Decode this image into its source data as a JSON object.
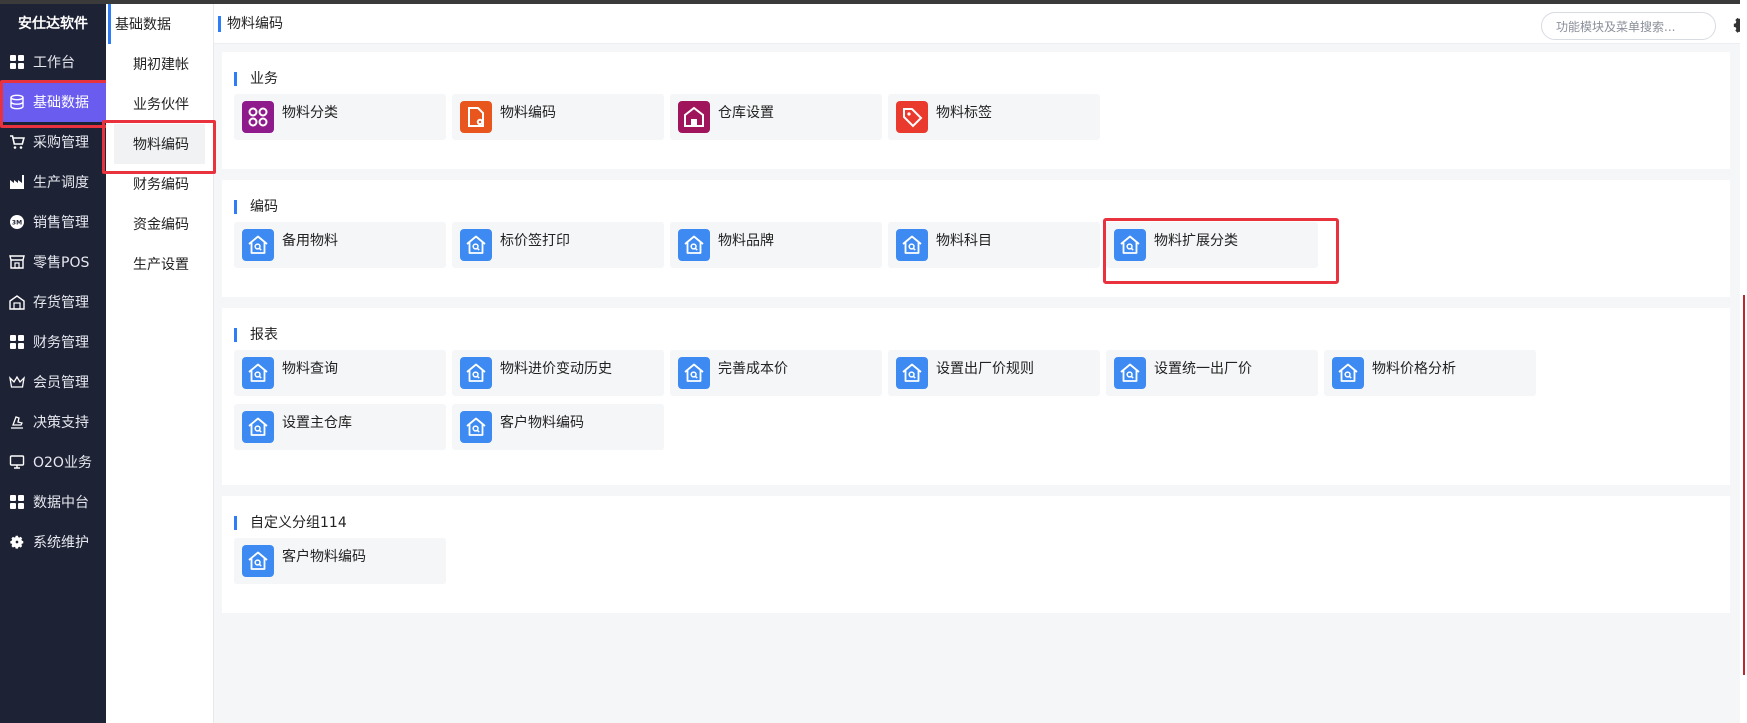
{
  "app": {
    "name": "安仕达软件"
  },
  "nav": {
    "items": [
      {
        "label": "工作台",
        "icon": "grid-icon"
      },
      {
        "label": "基础数据",
        "icon": "database-icon",
        "active": true
      },
      {
        "label": "采购管理",
        "icon": "cart-icon"
      },
      {
        "label": "生产调度",
        "icon": "factory-icon"
      },
      {
        "label": "销售管理",
        "icon": "sales-badge-icon"
      },
      {
        "label": "零售POS",
        "icon": "store-icon"
      },
      {
        "label": "存货管理",
        "icon": "warehouse-icon"
      },
      {
        "label": "财务管理",
        "icon": "grid-icon"
      },
      {
        "label": "会员管理",
        "icon": "crown-icon"
      },
      {
        "label": "决策支持",
        "icon": "hand-icon"
      },
      {
        "label": "O2O业务",
        "icon": "monitor-icon"
      },
      {
        "label": "数据中台",
        "icon": "grid-icon"
      },
      {
        "label": "系统维护",
        "icon": "gear-icon"
      }
    ]
  },
  "submenu": {
    "heading": "基础数据",
    "items": [
      {
        "label": "期初建帐"
      },
      {
        "label": "业务伙伴"
      },
      {
        "label": "物料编码",
        "active": true
      },
      {
        "label": "财务编码"
      },
      {
        "label": "资金编码"
      },
      {
        "label": "生产设置"
      }
    ]
  },
  "header": {
    "title": "物料编码",
    "search_placeholder": "功能模块及菜单搜索..."
  },
  "sections": [
    {
      "title": "业务",
      "cards": [
        {
          "label": "物料分类",
          "icon": "category-icon",
          "color": "#8e1a8c"
        },
        {
          "label": "物料编码",
          "icon": "file-gear-icon",
          "color": "#e8561e"
        },
        {
          "label": "仓库设置",
          "icon": "house-icon",
          "color": "#a0145c"
        },
        {
          "label": "物料标签",
          "icon": "tag-icon",
          "color": "#ea3a2e"
        }
      ]
    },
    {
      "title": "编码",
      "cards": [
        {
          "label": "备用物料",
          "icon": "house-search-icon",
          "color": "#3d8bf2"
        },
        {
          "label": "标价签打印",
          "icon": "house-search-icon",
          "color": "#3d8bf2"
        },
        {
          "label": "物料品牌",
          "icon": "house-search-icon",
          "color": "#3d8bf2"
        },
        {
          "label": "物料科目",
          "icon": "house-search-icon",
          "color": "#3d8bf2"
        },
        {
          "label": "物料扩展分类",
          "icon": "house-search-icon",
          "color": "#3d8bf2",
          "highlight": true
        }
      ]
    },
    {
      "title": "报表",
      "cards": [
        {
          "label": "物料查询",
          "icon": "house-search-icon",
          "color": "#3d8bf2"
        },
        {
          "label": "物料进价变动历史",
          "icon": "house-search-icon",
          "color": "#3d8bf2"
        },
        {
          "label": "完善成本价",
          "icon": "house-search-icon",
          "color": "#3d8bf2"
        },
        {
          "label": "设置出厂价规则",
          "icon": "house-search-icon",
          "color": "#3d8bf2"
        },
        {
          "label": "设置统一出厂价",
          "icon": "house-search-icon",
          "color": "#3d8bf2"
        },
        {
          "label": "物料价格分析",
          "icon": "house-search-icon",
          "color": "#3d8bf2"
        },
        {
          "label": "设置主仓库",
          "icon": "house-search-icon",
          "color": "#3d8bf2"
        },
        {
          "label": "客户物料编码",
          "icon": "house-search-icon",
          "color": "#3d8bf2"
        }
      ]
    },
    {
      "title": "自定义分组114",
      "cards": [
        {
          "label": "客户物料编码",
          "icon": "house-search-icon",
          "color": "#3d8bf2"
        }
      ]
    }
  ]
}
